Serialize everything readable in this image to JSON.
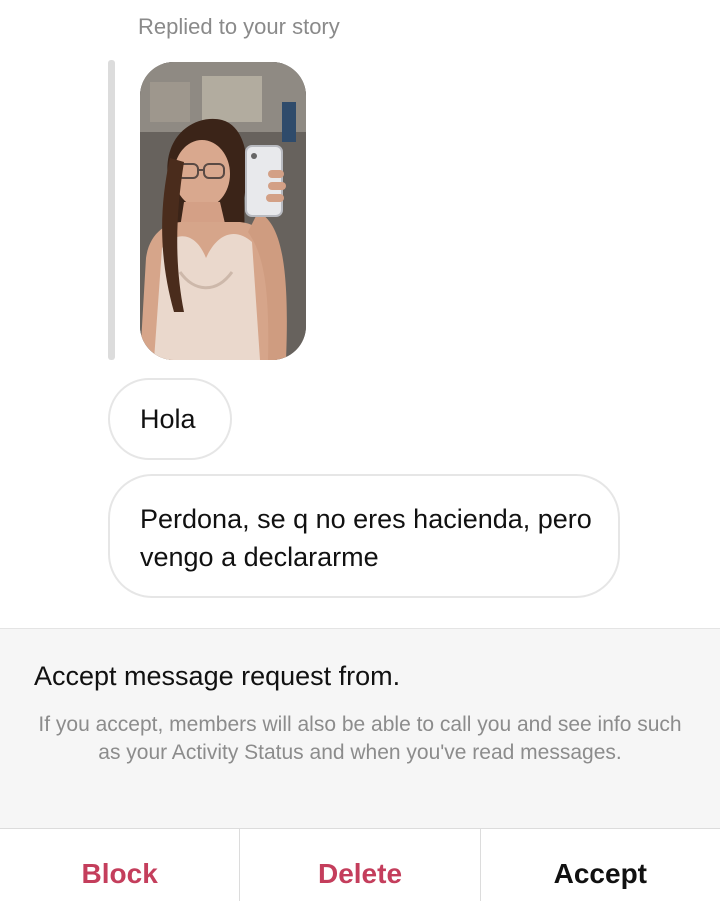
{
  "thread": {
    "story_reply_label": "Replied to your story",
    "messages": [
      {
        "text": "Hola"
      },
      {
        "text": "Perdona, se q no eres hacienda, pero vengo a declararme"
      }
    ]
  },
  "request": {
    "title": "Accept message request from.",
    "body": "If you accept, members will also be able to call you and see info such as your Activity Status and when you've read messages."
  },
  "actions": {
    "block_label": "Block",
    "delete_label": "Delete",
    "accept_label": "Accept"
  },
  "colors": {
    "destructive": "#c43e5c",
    "secondary_text": "#8c8c8c",
    "bubble_border": "#e6e6e6"
  }
}
